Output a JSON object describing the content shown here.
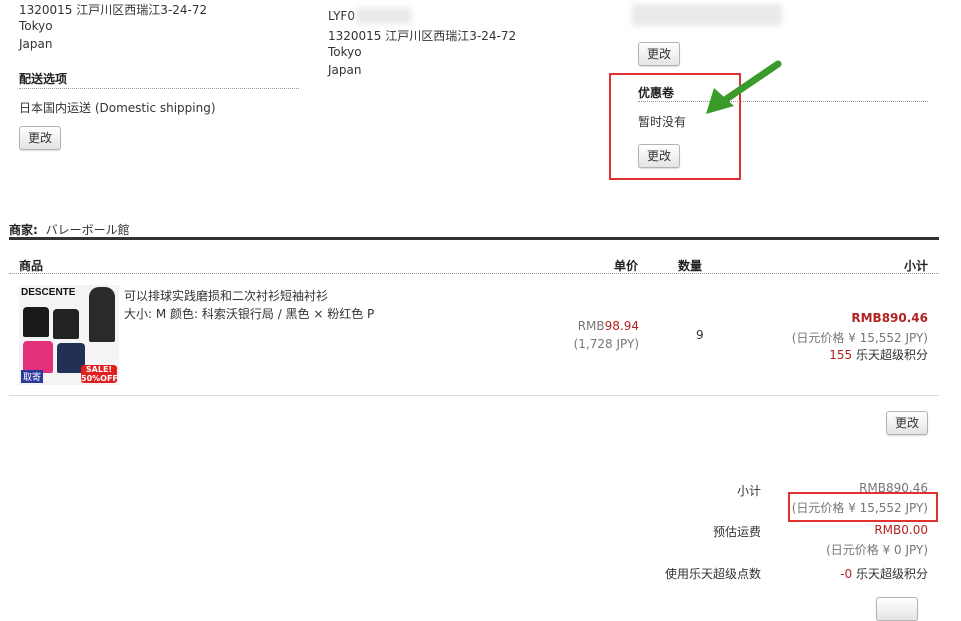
{
  "addr_left": {
    "postal_line": "1320015 江戸川区西瑞江3-24-72",
    "city": "Tokyo",
    "country": "Japan"
  },
  "addr_mid": {
    "name_partial": "LYF0",
    "postal_line": "1320015 江戸川区西瑞江3-24-72",
    "city": "Tokyo",
    "country": "Japan"
  },
  "shipping": {
    "heading": "配送选项",
    "option": "日本国内运送 (Domestic shipping)",
    "change_label": "更改"
  },
  "payment": {
    "change_label": "更改"
  },
  "coupon": {
    "heading": "优惠卷",
    "status": "暂时没有",
    "change_label": "更改",
    "highlight_color": "#e03030",
    "arrow_color": "#3a9a2a"
  },
  "shop": {
    "label": "商家:",
    "name": "バレーボール館"
  },
  "table": {
    "headers": {
      "product": "商品",
      "unit_price": "单价",
      "quantity": "数量",
      "subtotal": "小计"
    },
    "item": {
      "thumb_brand": "DESCENTE",
      "thumb_sale": "SALE! 50%OFF!",
      "thumb_tag": "取寄",
      "title": "可以排球实践磨损和二次衬衫短袖衬衫",
      "options": "大小: M 颜色: 科索沃银行局 / 黑色 × 粉红色 P",
      "price_prefix": "RMB",
      "price_value": "98.94",
      "price_jpy": "(1,728 JPY)",
      "quantity": "9",
      "subtotal_rmb": "RMB890.46",
      "subtotal_jpy": "(日元价格 ¥ 15,552 JPY)",
      "points_value": "155",
      "points_label": " 乐天超级积分"
    },
    "change_label": "更改"
  },
  "summary": {
    "subtotal_label": "小计",
    "subtotal_rmb": "RMB890.46",
    "subtotal_jpy": "(日元价格 ¥ 15,552 JPY)",
    "shipping_label": "预估运费",
    "shipping_rmb": "RMB0.00",
    "shipping_jpy": "(日元价格 ¥ 0 JPY)",
    "points_label": "使用乐天超级点数",
    "points_value": "-0",
    "points_unit": " 乐天超级积分"
  }
}
